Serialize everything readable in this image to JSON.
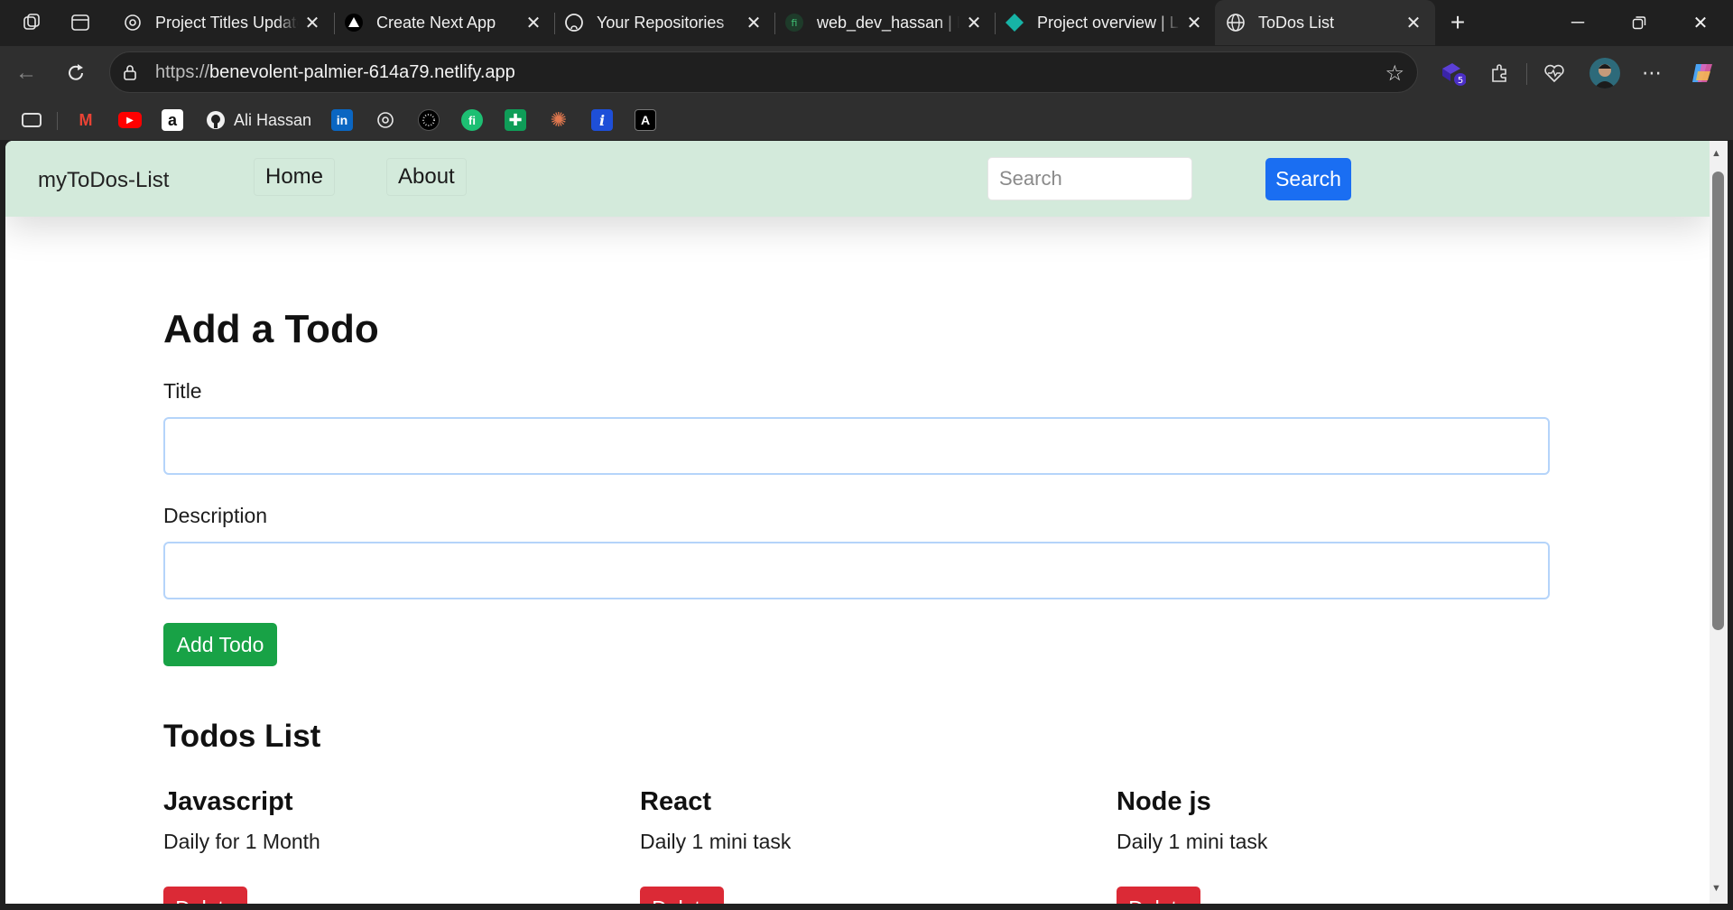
{
  "browser": {
    "tabs": [
      {
        "title": "Project Titles Update",
        "icon": "chatgpt-icon"
      },
      {
        "title": "Create Next App",
        "icon": "nextjs-triangle-icon"
      },
      {
        "title": "Your Repositories",
        "icon": "github-icon"
      },
      {
        "title": "web_dev_hassan | F",
        "icon": "fiverr-icon"
      },
      {
        "title": "Project overview | L",
        "icon": "diamond-icon"
      },
      {
        "title": "ToDos List",
        "icon": "globe-icon"
      }
    ],
    "url_protocol": "https://",
    "url_host": "benevolent-palmier-614a79.netlify.app",
    "extension_badge": "5",
    "bookmarks": {
      "github_label": "Ali Hassan"
    }
  },
  "page": {
    "brand": "myToDos-List",
    "nav": {
      "home": "Home",
      "about": "About"
    },
    "search": {
      "placeholder": "Search",
      "button": "Search"
    },
    "form": {
      "heading": "Add a Todo",
      "title_label": "Title",
      "title_value": "",
      "description_label": "Description",
      "description_value": "",
      "submit": "Add Todo"
    },
    "list": {
      "heading": "Todos List",
      "delete_label": "Delete",
      "items": [
        {
          "title": "Javascript",
          "desc": "Daily for 1 Month"
        },
        {
          "title": "React",
          "desc": "Daily 1 mini task"
        },
        {
          "title": "Node js",
          "desc": "Daily 1 mini task"
        }
      ]
    }
  },
  "colors": {
    "navbar": "#d3eadb",
    "primary": "#1a6ef2",
    "success": "#18a246",
    "danger": "#db2a36"
  }
}
